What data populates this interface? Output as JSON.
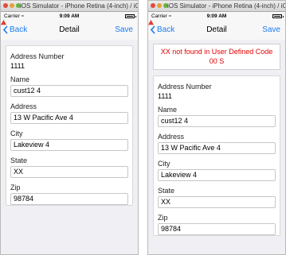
{
  "simulator_title": "iOS Simulator - iPhone Retina (4-inch) / iOS 7...",
  "status": {
    "carrier": "Carrier",
    "time": "9:09 AM"
  },
  "nav": {
    "back": "Back",
    "title": "Detail",
    "save": "Save"
  },
  "error_message": "XX not found in User Defined Code 00 S",
  "form": {
    "address_number_label": "Address Number",
    "address_number": "1111",
    "name_label": "Name",
    "name": "cust12 4",
    "address_label": "Address",
    "address": "13 W Pacific Ave 4",
    "city_label": "City",
    "city": "Lakeview 4",
    "state_label": "State",
    "state": "XX",
    "zip_label": "Zip",
    "zip": "98784"
  },
  "colors": {
    "accent": "#1a7cf0",
    "error": "#e60000",
    "background": "#efeff4"
  }
}
